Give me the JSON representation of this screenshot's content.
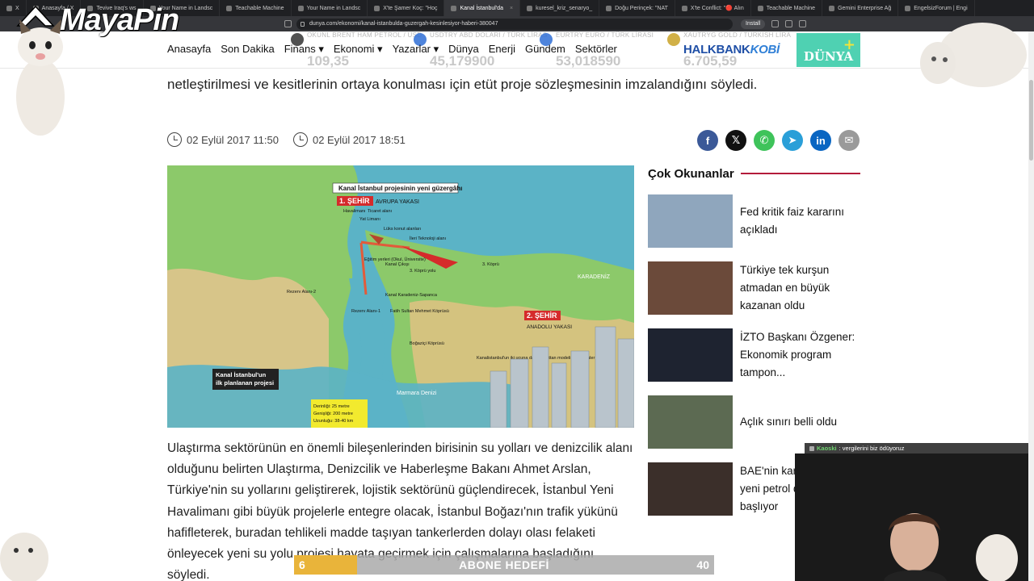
{
  "browser": {
    "tabs": [
      {
        "label": "X",
        "active": false
      },
      {
        "label": "Anasayfa / X",
        "active": false
      },
      {
        "label": "Tevive Iraq's ws",
        "active": false
      },
      {
        "label": "Your Name in Landsc",
        "active": false
      },
      {
        "label": "Teachable Machine",
        "active": false
      },
      {
        "label": "Your Name in Landsc",
        "active": false
      },
      {
        "label": "X'te Şamer Koç: \"Hoç",
        "active": false
      },
      {
        "label": "Kanal İstanbul'da",
        "active": true
      },
      {
        "label": "kuresel_kriz_senaryo_",
        "active": false
      },
      {
        "label": "Doğu Perinçek: \"NAT",
        "active": false
      },
      {
        "label": "X'te Conflict: \"🔴 Alın",
        "active": false
      },
      {
        "label": "Teachable Machine",
        "active": false
      },
      {
        "label": "Gemini Enterprise Ağ",
        "active": false
      },
      {
        "label": "EngelsizForum | Engi",
        "active": false
      }
    ],
    "url": "dunya.com/ekonomi/kanal-istanbulda-guzergah-kesinlesiyor-haberi-380047",
    "install_label": "Install"
  },
  "nav": {
    "items": [
      "Anasayfa",
      "Son Dakika",
      "Finans",
      "Ekonomi",
      "Yazarlar",
      "Dünya",
      "Enerji",
      "Gündem",
      "Sektörler"
    ],
    "dropdown_items": [
      "Finans",
      "Ekonomi",
      "Yazarlar"
    ],
    "tickers": [
      {
        "name": "BRENT HAM PETROL / USD",
        "code": "OKUNL",
        "value": "109,35",
        "icon_color": "#333333"
      },
      {
        "name": "ABD DOLARI / TÜRK LİRAS",
        "code": "USDTRY",
        "value": "45,179900",
        "icon_color": "#2f6fd6"
      },
      {
        "name": "EURO / TÜRK LİRASI",
        "code": "EURTRY",
        "value": "53,018590",
        "icon_color": "#2f6fd6"
      },
      {
        "name": "GOLD / TURKISH LİRA",
        "code": "XAUTRYG",
        "value": "6.705,59",
        "icon_color": "#c9a227"
      }
    ],
    "sponsor": "HALKBANK",
    "sponsor_suffix": "KOBİ",
    "logo": "DÜNYA",
    "logo_plus": "+"
  },
  "article": {
    "lead": "netleştirilmesi ve kesitlerinin ortaya konulması için etüt proje sözleşmesinin imzalandığını söyledi.",
    "published": "02 Eylül 2017 11:50",
    "updated": "02 Eylül 2017 18:51",
    "share": [
      {
        "name": "facebook",
        "glyph": "f",
        "color": "#3b5998"
      },
      {
        "name": "x",
        "glyph": "𝕏",
        "color": "#111111"
      },
      {
        "name": "whatsapp",
        "glyph": "✆",
        "color": "#3ec35a"
      },
      {
        "name": "telegram",
        "glyph": "➤",
        "color": "#2a9fd8"
      },
      {
        "name": "linkedin",
        "glyph": "in",
        "color": "#0a66c2"
      },
      {
        "name": "email",
        "glyph": "✉",
        "color": "#9a9a9a"
      }
    ],
    "map": {
      "title": "Kanal İstanbul projesinin yeni güzergâhı",
      "city1": "1. ŞEHİR",
      "city1_side": "AVRUPA YAKASI",
      "city2": "2. ŞEHİR",
      "city2_side": "ANADOLU YAKASI",
      "labels": [
        "Havalimanı",
        "Ticaret alanı",
        "Yat Limanı",
        "Lüks konut alanları",
        "İleri Teknoloji alanı",
        "Eğitim yerleri (Okul, Üniversite)",
        "Kanal Çıkışı",
        "3. Köprü yolu",
        "3. Köprü",
        "Kanal Karadeniz-Sapanca",
        "Fatih Sultan Mehmet Köprüsü",
        "Boğaziçi Köprüsü",
        "Kanal İstanbul'un ilk planlanan projesi",
        "KARADENİZ",
        "Marmara Denizi",
        "Rezerv Alanı-1",
        "Rezerv Alanı-2",
        "Kanalistanbul'un iki ucuna da Manhattan modeli gökdelenler"
      ],
      "caption": "Kanal İstanbul'un ilk planlanan projesi",
      "stats": [
        "Derinliği: 25 metre",
        "Genişliği: 200 metre",
        "Uzunluğu: 38-40 km"
      ]
    },
    "body": "Ulaştırma sektörünün en önemli bileşenlerinden birisinin su yolları ve denizcilik alanı olduğunu belirten Ulaştırma, Denizcilik ve Haberleşme Bakanı Ahmet Arslan, Türkiye'nin su yollarını geliştirerek, lojistik sektörünü güçlendirecek, İstanbul Yeni Havalimanı gibi büyük projelerle entegre olacak, İstanbul Boğazı'nın trafik yükünü hafifleterek, buradan tehlikeli madde taşıyan tankerlerden dolayı olası felaketi önleyecek yeni su yolu projesi hayata geçirmek için çalışmalarına başladığını söyledi."
  },
  "sidebar": {
    "title": "Çok Okunanlar",
    "items": [
      {
        "text": "Fed kritik faiz kararını açıkladı",
        "thumb_color": "#8fa6bd"
      },
      {
        "text": "Türkiye tek kurşun atmadan en büyük kazanan oldu",
        "thumb_color": "#6b4a3a"
      },
      {
        "text": "İZTO Başkanı Özgener: Ekonomik program tampon...",
        "thumb_color": "#1e2330"
      },
      {
        "text": "Açlık sınırı belli oldu",
        "thumb_color": "#5c6a52"
      },
      {
        "text": "BAE'nin kararı sonrası yeni petrol dönemi başlıyor",
        "thumb_color": "#3b2f2a"
      }
    ]
  },
  "overlays": {
    "channel_logo": "MayaPin",
    "chat_user": "Kaoski",
    "chat_message": ": vergilerini biz ödüyoruz",
    "goal_label": "ABONE HEDEFİ",
    "goal_current": "6",
    "goal_max": "40",
    "goal_fraction": 0.15
  }
}
